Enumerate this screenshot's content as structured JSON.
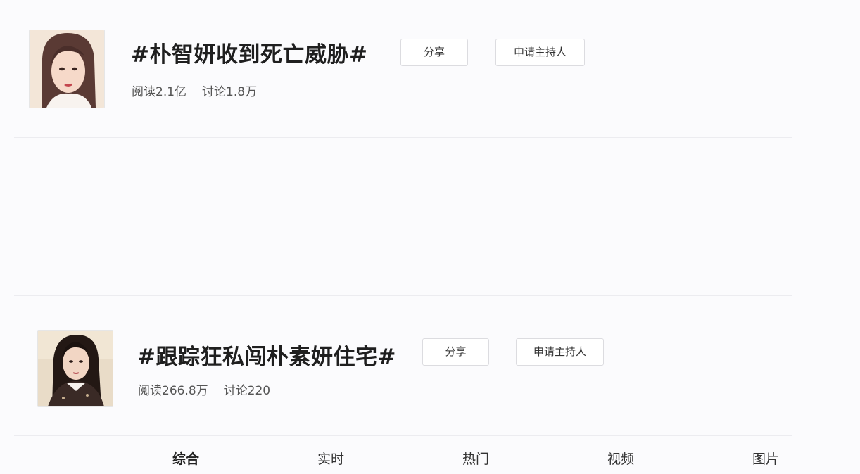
{
  "topics": [
    {
      "title": "#朴智妍收到死亡威胁#",
      "share_label": "分享",
      "host_label": "申请主持人",
      "reads": "阅读2.1亿",
      "discussions": "讨论1.8万"
    },
    {
      "title": "#跟踪狂私闯朴素妍住宅#",
      "share_label": "分享",
      "host_label": "申请主持人",
      "reads": "阅读266.8万",
      "discussions": "讨论220"
    }
  ],
  "tabs": [
    "综合",
    "实时",
    "热门",
    "视频",
    "图片"
  ],
  "active_tab": "综合"
}
